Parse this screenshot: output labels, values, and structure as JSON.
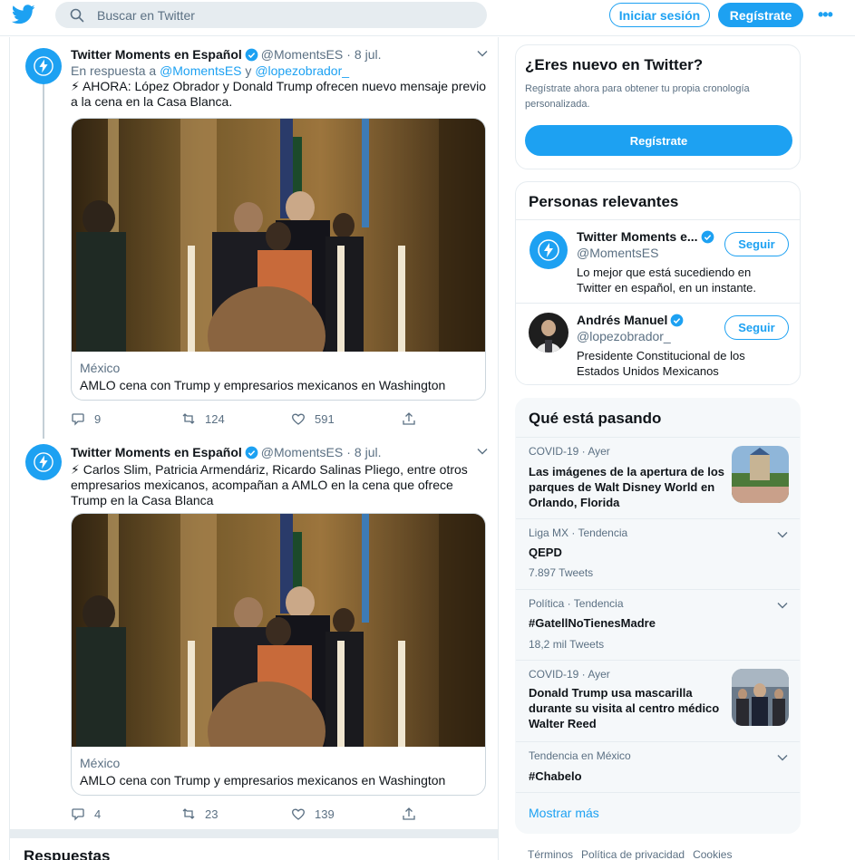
{
  "topbar": {
    "search_placeholder": "Buscar en Twitter",
    "login_label": "Iniciar sesión",
    "signup_label": "Regístrate",
    "more_label": "•••"
  },
  "tweets": [
    {
      "name": "Twitter Moments en Español",
      "handle": "@MomentsES",
      "dot": "·",
      "date": "8 jul.",
      "reply_prefix": "En respuesta a",
      "reply_user1": "@MomentsES",
      "reply_and": "y",
      "reply_user2": "@lopezobrador_",
      "text": "⚡ AHORA: López Obrador y Donald Trump ofrecen nuevo mensaje previo a la cena en la Casa Blanca.",
      "card_domain": "México",
      "card_title": "AMLO cena con Trump y empresarios mexicanos en Washington",
      "replies": "9",
      "retweets": "124",
      "likes": "591"
    },
    {
      "name": "Twitter Moments en Español",
      "handle": "@MomentsES",
      "dot": "·",
      "date": "8 jul.",
      "text": "⚡ Carlos Slim, Patricia Armendáriz, Ricardo Salinas Pliego, entre otros empresarios mexicanos, acompañan a AMLO en la cena que ofrece Trump en la Casa Blanca",
      "card_domain": "México",
      "card_title": "AMLO cena con Trump y empresarios mexicanos en Washington",
      "replies": "4",
      "retweets": "23",
      "likes": "139"
    }
  ],
  "respuestas_label": "Respuestas",
  "new_box": {
    "title": "¿Eres nuevo en Twitter?",
    "desc": "Regístrate ahora para obtener tu propia cronología personalizada.",
    "button": "Regístrate"
  },
  "people": {
    "title": "Personas relevantes",
    "items": [
      {
        "name": "Twitter Moments e...",
        "handle": "@MomentsES",
        "bio": "Lo mejor que está sucediendo en Twitter en español, en un instante.",
        "follow": "Seguir"
      },
      {
        "name": "Andrés Manuel",
        "handle": "@lopezobrador_",
        "bio": "Presidente Constitucional de los Estados Unidos Mexicanos",
        "follow": "Seguir"
      }
    ]
  },
  "trends": {
    "title": "Qué está pasando",
    "items": [
      {
        "context": "COVID-19 · Ayer",
        "title": "Las imágenes de la apertura de los parques de Walt Disney World en Orlando, Florida",
        "sub": ""
      },
      {
        "context": "Liga MX · Tendencia",
        "title": "QEPD",
        "sub": "7.897 Tweets"
      },
      {
        "context": "Política · Tendencia",
        "title": "#GatellNoTienesMadre",
        "sub": "18,2 mil Tweets"
      },
      {
        "context": "COVID-19 · Ayer",
        "title": "Donald Trump usa mascarilla durante su visita al centro médico Walter Reed",
        "sub": ""
      },
      {
        "context": "Tendencia en México",
        "title": "#Chabelo",
        "sub": ""
      }
    ],
    "show_more": "Mostrar más"
  },
  "footer": {
    "terms": "Términos",
    "privacy": "Política de privacidad",
    "cookies": "Cookies"
  },
  "colors": {
    "accent": "#1da1f2",
    "text": "#0f1419",
    "secondary": "#5b7083",
    "border": "#e6ecf0"
  }
}
